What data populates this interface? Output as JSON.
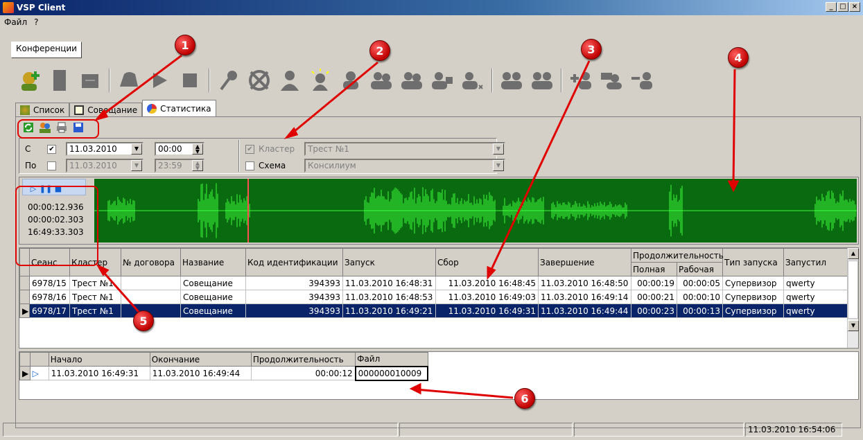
{
  "window": {
    "title": "VSP Client"
  },
  "menu": [
    "Файл",
    "?"
  ],
  "top_tab": {
    "label": "Конференции"
  },
  "big_toolbar_icons": [
    "add-participant-icon",
    "door-icon",
    "keypad-icon",
    "phone-icon",
    "play-icon",
    "stop-icon",
    "microphone-icon",
    "wheel-icon",
    "mute-user-icon",
    "alarm-user-icon",
    "user-icon",
    "user-add-icon",
    "users-icon",
    "user-phone-icon",
    "user-remove-icon",
    "user-group-icon",
    "user-group2-icon",
    "plus-users-icon",
    "chat-users-icon",
    "minus-users-icon"
  ],
  "tabs": [
    {
      "label": "Список",
      "icon": "list-icon"
    },
    {
      "label": "Совещание",
      "icon": "meeting-icon"
    },
    {
      "label": "Статистика",
      "icon": "statistics-icon"
    }
  ],
  "small_toolbar_icons": [
    "refresh-icon",
    "users-settings-icon",
    "print-icon",
    "save-icon"
  ],
  "filter": {
    "from_label": "С",
    "from_checked": true,
    "from_date": "11.03.2010",
    "from_time": "00:00",
    "to_label": "По",
    "to_checked": false,
    "to_date": "11.03.2010",
    "to_time": "23:59",
    "cluster_label": "Кластер",
    "cluster_checked": true,
    "cluster_value": "Трест №1",
    "scheme_label": "Схема",
    "scheme_checked": false,
    "scheme_value": "Консилиум"
  },
  "player": {
    "time1": "00:00:12.936",
    "time2": "00:00:02.303",
    "time3": "16:49:33.303"
  },
  "sessions": {
    "headers": {
      "seans": "Сеанс",
      "cluster": "Кластер",
      "contract": "№ договора",
      "name": "Название",
      "code": "Код идентификации",
      "start": "Запуск",
      "collect": "Сбор",
      "end": "Завершение",
      "duration": "Продолжительность",
      "full": "Полная",
      "work": "Рабочая",
      "start_type": "Тип запуска",
      "launched_by": "Запустил"
    },
    "rows": [
      {
        "seans": "6978/15",
        "cluster": "Трест №1",
        "contract": "",
        "name": "Совещание",
        "code": "394393",
        "start": "11.03.2010 16:48:31",
        "collect": "11.03.2010 16:48:45",
        "end": "11.03.2010 16:48:50",
        "full": "00:00:19",
        "work": "00:00:05",
        "start_type": "Супервизор",
        "launched_by": "qwerty"
      },
      {
        "seans": "6978/16",
        "cluster": "Трест №1",
        "contract": "",
        "name": "Совещание",
        "code": "394393",
        "start": "11.03.2010 16:48:53",
        "collect": "11.03.2010 16:49:03",
        "end": "11.03.2010 16:49:14",
        "full": "00:00:21",
        "work": "00:00:10",
        "start_type": "Супервизор",
        "launched_by": "qwerty"
      },
      {
        "seans": "6978/17",
        "cluster": "Трест №1",
        "contract": "",
        "name": "Совещание",
        "code": "394393",
        "start": "11.03.2010 16:49:21",
        "collect": "11.03.2010 16:49:31",
        "end": "11.03.2010 16:49:44",
        "full": "00:00:23",
        "work": "00:00:13",
        "start_type": "Супервизор",
        "launched_by": "qwerty"
      }
    ]
  },
  "records": {
    "headers": {
      "begin": "Начало",
      "finish": "Окончание",
      "duration": "Продолжительность",
      "file": "Файл"
    },
    "rows": [
      {
        "begin": "11.03.2010 16:49:31",
        "finish": "11.03.2010 16:49:44",
        "duration": "00:00:12",
        "file": "000000010009"
      }
    ]
  },
  "statusbar": {
    "datetime": "11.03.2010 16:54:06"
  },
  "annotations": [
    "1",
    "2",
    "3",
    "4",
    "5",
    "6"
  ],
  "colors": {
    "waveform_bg": "#0a6a10",
    "waveform": "#3cff3c",
    "selection": "#0a246a",
    "annotation": "#e00000"
  }
}
